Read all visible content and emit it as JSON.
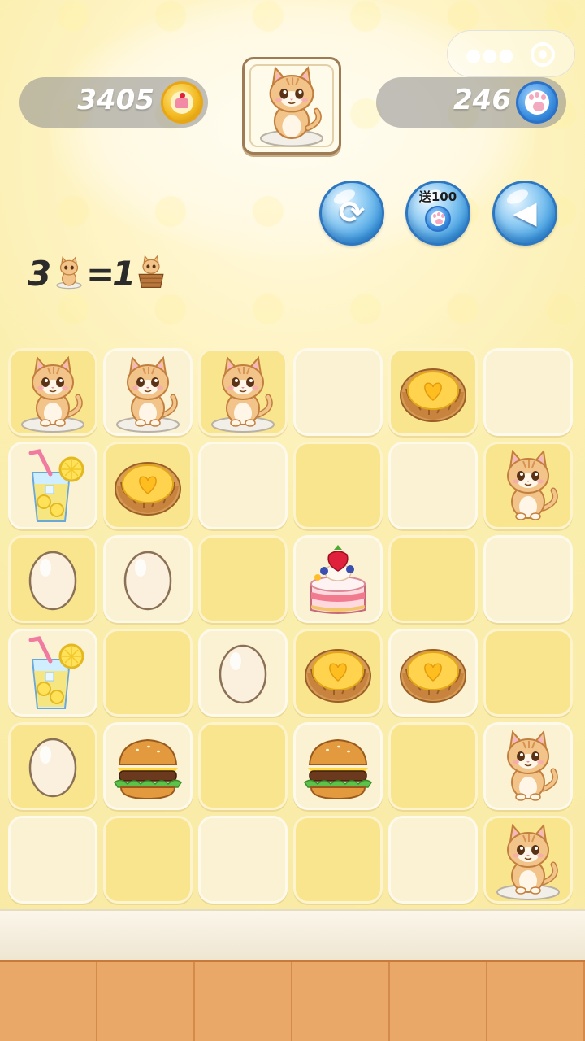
{
  "currency": {
    "coins": "3405",
    "coin_icon": "cake-coin-icon",
    "paw_tokens": "246",
    "paw_icon": "paw-token-icon"
  },
  "wechat_capsule": {
    "menu_icon": "more-dots-icon",
    "close_icon": "target-close-icon"
  },
  "target_item": "cat-on-plate",
  "actions": [
    {
      "id": "refresh",
      "icon": "refresh-arrows-icon",
      "glyph": "⟳"
    },
    {
      "id": "gift",
      "label": "送100",
      "icon": "paw-token-icon"
    },
    {
      "id": "undo",
      "icon": "arrow-left-icon",
      "glyph": "◀"
    }
  ],
  "rule": {
    "left_count": "3",
    "left_item": "cat-on-plate",
    "equals": "=",
    "right_count": "1",
    "right_item": "cat-in-basket"
  },
  "board": {
    "rows": 6,
    "cols": 6,
    "grid": [
      [
        "cat-on-plate",
        "cat-on-plate",
        "cat-on-plate",
        "",
        "egg-tart",
        ""
      ],
      [
        "lemonade",
        "egg-tart",
        "",
        "",
        "",
        "cat"
      ],
      [
        "egg",
        "egg",
        "",
        "strawberry-cake",
        "",
        ""
      ],
      [
        "lemonade",
        "",
        "egg",
        "egg-tart",
        "egg-tart",
        ""
      ],
      [
        "egg",
        "burger",
        "",
        "burger",
        "",
        "cat"
      ],
      [
        "",
        "",
        "",
        "",
        "",
        "cat-on-plate"
      ]
    ],
    "shade": [
      [
        "dark",
        "light",
        "dark",
        "light",
        "dark",
        "light"
      ],
      [
        "light",
        "dark",
        "light",
        "dark",
        "light",
        "dark"
      ],
      [
        "dark",
        "light",
        "dark",
        "light",
        "dark",
        "light"
      ],
      [
        "light",
        "dark",
        "light",
        "dark",
        "light",
        "dark"
      ],
      [
        "dark",
        "light",
        "dark",
        "light",
        "dark",
        "light"
      ],
      [
        "light",
        "dark",
        "light",
        "dark",
        "light",
        "dark"
      ]
    ]
  },
  "colors": {
    "wall": "#fbefb0",
    "tile_light": "#fbf1d3",
    "tile_dark": "#fae58f",
    "button_blue": "#3e9ce0",
    "floor": "#e9a867"
  }
}
